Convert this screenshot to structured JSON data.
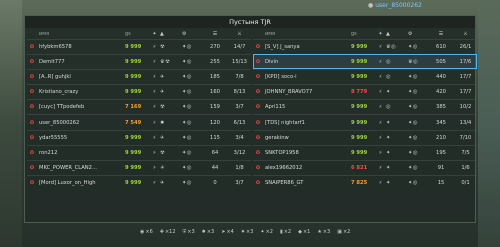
{
  "top": {
    "player_name": "user_85000262"
  },
  "title": "Пустыня TJR",
  "header": {
    "name": "имя",
    "gs": "GS",
    "score": "очк",
    "kd": "у/с"
  },
  "colors": {
    "gs_green": "#9fd63a",
    "gs_orange": "#f0a030",
    "gs_red": "#ff4646",
    "highlight": "#4fb8e8"
  },
  "left_team": [
    {
      "rank_icon": "rank-star-icon",
      "name": "hfybkm6578",
      "gs": "9 999",
      "gs_color": "#9fd63a",
      "i1": "⚡",
      "i2": "☢",
      "i3": "✦◎",
      "score": "270",
      "kd": "14/7"
    },
    {
      "rank_icon": "rank-star-icon",
      "name": "Demit777",
      "gs": "9 999",
      "gs_color": "#9fd63a",
      "i1": "⚡",
      "i2": "♛☢",
      "i3": "✦◎",
      "score": "255",
      "kd": "15/13"
    },
    {
      "rank_icon": "rank-star-icon",
      "name": "[A..R] guhjkl",
      "gs": "9 999",
      "gs_color": "#9fd63a",
      "i1": "⚡",
      "i2": "✈",
      "i3": "✦◎",
      "score": "185",
      "kd": "7/8"
    },
    {
      "rank_icon": "rank-star-icon",
      "name": "Kristiano_crazy",
      "gs": "9 999",
      "gs_color": "#9fd63a",
      "i1": "⚡",
      "i2": "✈",
      "i3": "✦◎",
      "score": "160",
      "kd": "8/13"
    },
    {
      "rank_icon": "rank-star-icon",
      "name": "[cuyc] TTpodefeb",
      "gs": "7 169",
      "gs_color": "#f0a030",
      "i1": "⚡",
      "i2": "☢",
      "i3": "✦◎",
      "score": "159",
      "kd": "3/7"
    },
    {
      "rank_icon": "rank-star-icon",
      "name": "user_85000262",
      "gs": "7 549",
      "gs_color": "#f0a030",
      "i1": "⚡",
      "i2": "✸",
      "i3": "✦◎",
      "score": "120",
      "kd": "6/13"
    },
    {
      "rank_icon": "rank-star-icon",
      "name": "ydar55555",
      "gs": "9 999",
      "gs_color": "#9fd63a",
      "i1": "⚡",
      "i2": "✈",
      "i3": "✦◎",
      "score": "115",
      "kd": "3/4"
    },
    {
      "rank_icon": "rank-star-icon",
      "name": "ron212",
      "gs": "9 999",
      "gs_color": "#9fd63a",
      "i1": "⚡",
      "i2": "☢",
      "i3": "✦◎",
      "score": "64",
      "kd": "3/12"
    },
    {
      "rank_icon": "rank-star-icon",
      "name": "MKC_POWER_CLAN2...",
      "gs": "9 999",
      "gs_color": "#9fd63a",
      "i1": "⚡",
      "i2": "☀",
      "i3": "✦◎",
      "score": "44",
      "kd": "1/8"
    },
    {
      "rank_icon": "rank-star-icon",
      "name": "[Mord] Luxor_on_High",
      "gs": "9 999",
      "gs_color": "#9fd63a",
      "i1": "⚡",
      "i2": "✈",
      "i3": "✦◎",
      "score": "0",
      "kd": "3/7"
    }
  ],
  "right_team": [
    {
      "rank_icon": "rank-star-icon",
      "name": "[S_V] J_sanya",
      "gs": "9 999",
      "gs_color": "#9fd63a",
      "i1": "⚡",
      "i2": "♛◎",
      "i3": "✦◎",
      "score": "610",
      "kd": "26/1"
    },
    {
      "rank_icon": "rank-star-icon",
      "name": "Divin",
      "gs": "9 999",
      "gs_color": "#9fd63a",
      "i1": "⚡",
      "i2": "◎",
      "i3": "♛◎",
      "score": "505",
      "kd": "17/6",
      "highlight": true
    },
    {
      "rank_icon": "rank-star-icon",
      "name": "[KPD] soco-i",
      "gs": "9 999",
      "gs_color": "#9fd63a",
      "i1": "⚡",
      "i2": "◎",
      "i3": "✦◎",
      "score": "440",
      "kd": "17/7"
    },
    {
      "rank_icon": "rank-star-icon",
      "name": "JOHNNY_BRAVO77",
      "gs": "8 779",
      "gs_color": "#ff4646",
      "i1": "⚡",
      "i2": "✦",
      "i3": "✦◎",
      "score": "420",
      "kd": "17/7"
    },
    {
      "rank_icon": "rank-star-icon",
      "name": "Apri115",
      "gs": "9 999",
      "gs_color": "#9fd63a",
      "i1": "⚡",
      "i2": "◎",
      "i3": "✦◎",
      "score": "385",
      "kd": "10/2"
    },
    {
      "rank_icon": "rank-star-icon",
      "name": "[TDS] nightarf1",
      "gs": "9 999",
      "gs_color": "#9fd63a",
      "i1": "⚡",
      "i2": "✦",
      "i3": "✦◎",
      "score": "345",
      "kd": "13/4"
    },
    {
      "rank_icon": "rank-star-icon",
      "name": "gerakinw",
      "gs": "9 999",
      "gs_color": "#9fd63a",
      "i1": "⚡",
      "i2": "✦",
      "i3": "✦◎",
      "score": "210",
      "kd": "7/10"
    },
    {
      "rank_icon": "rank-star-icon",
      "name": "SNKTOP1958",
      "gs": "9 999",
      "gs_color": "#9fd63a",
      "i1": "⚡",
      "i2": "✦",
      "i3": "✦◎",
      "score": "195",
      "kd": "7/5"
    },
    {
      "rank_icon": "rank-star-icon",
      "name": "alex19662012",
      "gs": "6 821",
      "gs_color": "#ff4646",
      "i1": "⚡",
      "i2": "✦",
      "i3": "✦◎",
      "score": "91",
      "kd": "1/6"
    },
    {
      "rank_icon": "rank-star-icon",
      "name": "SNAIPER86_GT",
      "gs": "7 825",
      "gs_color": "#f0a030",
      "i1": "⚡",
      "i2": "✦",
      "i3": "✦◎",
      "score": "15",
      "kd": "0/1"
    }
  ],
  "bottom_stats": [
    {
      "icon": "gold-box-icon",
      "glyph": "◉",
      "value": "×6"
    },
    {
      "icon": "repair-icon",
      "glyph": "✚",
      "value": "×12"
    },
    {
      "icon": "armor-icon",
      "glyph": "⛨",
      "value": "×3"
    },
    {
      "icon": "damage-icon",
      "glyph": "✸",
      "value": "×3"
    },
    {
      "icon": "speed-icon",
      "glyph": "➤",
      "value": "×4"
    },
    {
      "icon": "mine-icon",
      "glyph": "✷",
      "value": "×3"
    },
    {
      "icon": "supply-icon",
      "glyph": "✦",
      "value": "×2"
    },
    {
      "icon": "battery-icon",
      "glyph": "▮",
      "value": "×2"
    },
    {
      "icon": "crystal-icon",
      "glyph": "◆",
      "value": "×1"
    },
    {
      "icon": "star-icon",
      "glyph": "★",
      "value": "×3"
    },
    {
      "icon": "container-icon",
      "glyph": "▣",
      "value": "×2"
    }
  ]
}
